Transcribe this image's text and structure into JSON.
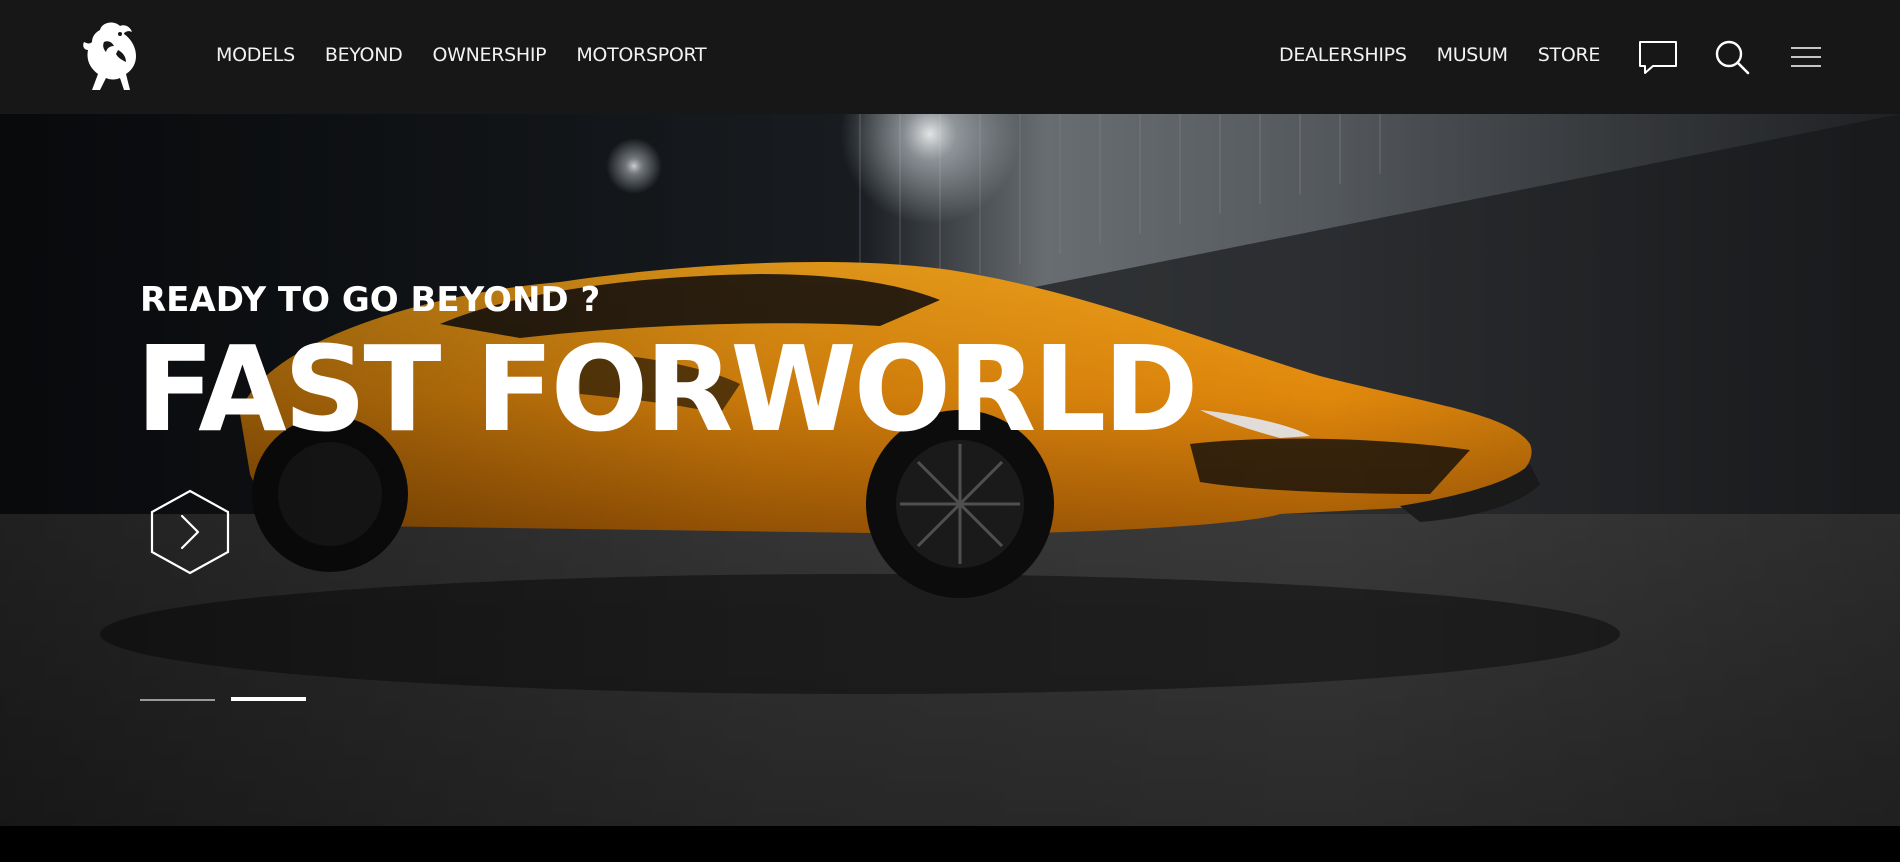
{
  "brand": {
    "logo_icon": "bull-emblem-icon"
  },
  "nav": {
    "left": [
      "MODELS",
      "BEYOND",
      "OWNERSHIP",
      "MOTORSPORT"
    ],
    "right": [
      "DEALERSHIPS",
      "MUSUM",
      "STORE"
    ],
    "icons": [
      "chat-icon",
      "search-icon",
      "menu-icon"
    ]
  },
  "hero": {
    "eyebrow": "READY TO GO BEYOND ?",
    "headline": "FAST FORWORLD",
    "next_icon": "hexagon-chevron-right-icon",
    "accent_color": "#e08a10",
    "slides": {
      "count": 2,
      "active": 2
    }
  }
}
